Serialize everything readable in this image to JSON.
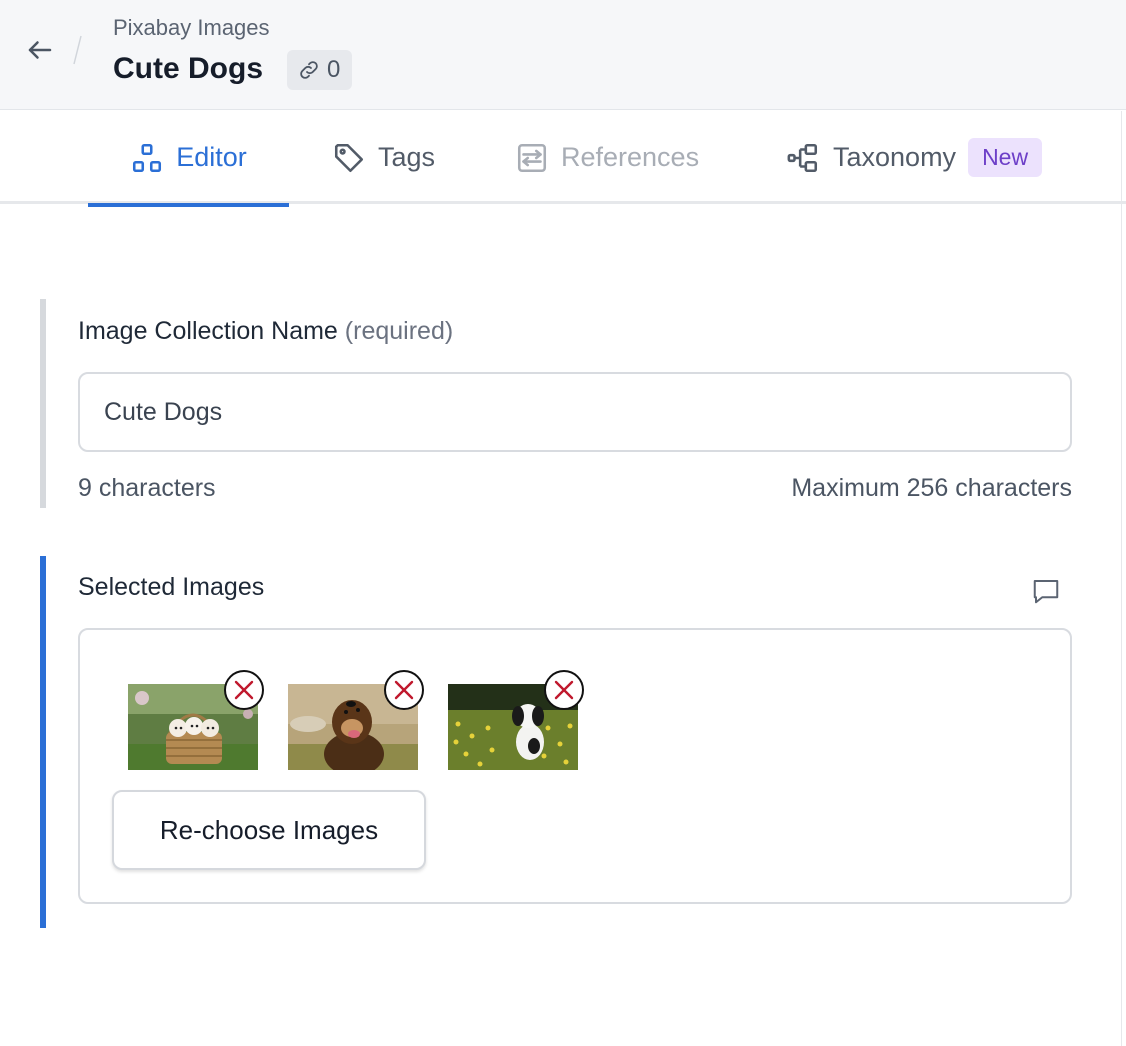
{
  "header": {
    "breadcrumb": "Pixabay Images",
    "title": "Cute Dogs",
    "link_count": "0",
    "back_icon": "arrow-left-icon",
    "link_icon": "link-icon"
  },
  "tabs": [
    {
      "label": "Editor",
      "icon": "blocks-icon",
      "active": true
    },
    {
      "label": "Tags",
      "icon": "tag-icon",
      "active": false
    },
    {
      "label": "References",
      "icon": "arrows-exchange-icon",
      "active": false,
      "disabled": true
    },
    {
      "label": "Taxonomy",
      "icon": "hierarchy-icon",
      "active": false,
      "badge": "New"
    }
  ],
  "name_field": {
    "label": "Image Collection Name",
    "required_label": "(required)",
    "value": "Cute Dogs",
    "char_count": "9 characters",
    "max_hint": "Maximum 256 characters"
  },
  "images_field": {
    "label": "Selected Images",
    "comment_icon": "comment-icon",
    "remove_icon": "close-icon",
    "images": [
      "puppies in basket",
      "dog looking up",
      "dog in flower field"
    ],
    "button_label": "Re-choose Images"
  },
  "colors": {
    "accent": "#2b6fd6",
    "badge_bg": "#ece2fd",
    "badge_text": "#6d3fc8",
    "remove_x": "#c0182d"
  }
}
